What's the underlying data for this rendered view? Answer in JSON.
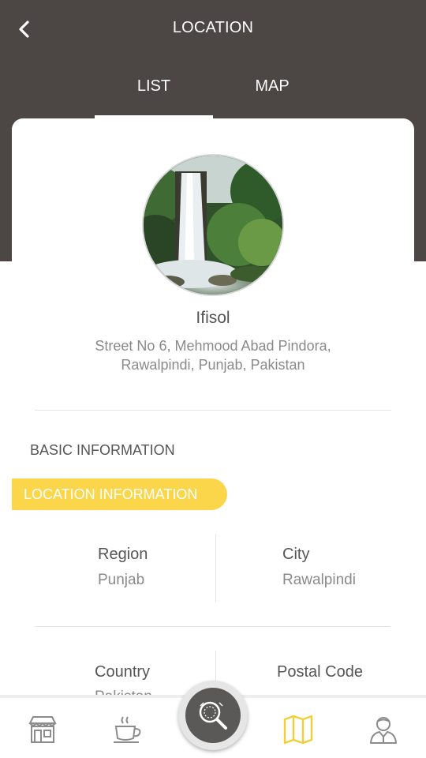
{
  "header": {
    "title": "LOCATION"
  },
  "tabs": [
    {
      "label": "LIST",
      "active": true
    },
    {
      "label": "MAP",
      "active": false
    }
  ],
  "place": {
    "name": "Ifisol",
    "address_line1": "Street No 6, Mehmood Abad Pindora,",
    "address_line2": "Rawalpindi, Punjab, Pakistan"
  },
  "sections": {
    "basic_information": "BASIC INFORMATION",
    "location_information": "LOCATION INFORMATION"
  },
  "fields": {
    "region": {
      "label": "Region",
      "value": "Punjab"
    },
    "city": {
      "label": "City",
      "value": "Rawalpindi"
    },
    "country": {
      "label": "Country",
      "value": "Pakistan"
    },
    "postal_code": {
      "label": "Postal Code",
      "value": ""
    }
  },
  "bottom_nav": {
    "items": [
      "store-icon",
      "coffee-icon",
      "search-icon",
      "map-icon",
      "user-icon"
    ],
    "active_item": "map-icon"
  },
  "colors": {
    "header_bg": "#4c4644",
    "accent": "#fbd64a",
    "text_dark": "#555555",
    "text_muted": "#8a8a8a"
  }
}
